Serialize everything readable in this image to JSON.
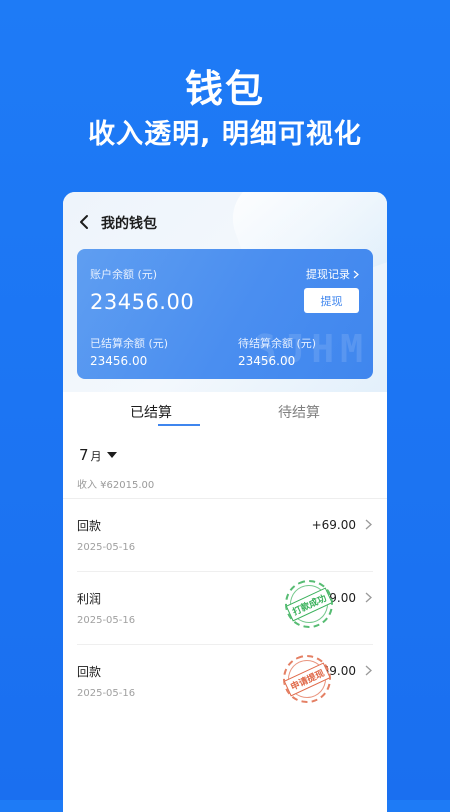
{
  "promo": {
    "title": "钱包",
    "subtitle": "收入透明, 明细可视化"
  },
  "nav": {
    "back_icon": "chevron-left-icon",
    "title": "我的钱包"
  },
  "balance_card": {
    "account_balance_label": "账户余额 (元)",
    "account_balance": "23456.00",
    "withdraw_record_label": "提现记录",
    "withdraw_button_label": "提现",
    "settled_label": "已结算余额 (元)",
    "settled_amount": "23456.00",
    "pending_label": "待结算余额 (元)",
    "pending_amount": "23456.00",
    "watermark": "SJHM"
  },
  "tabs": [
    {
      "label": "已结算",
      "active": true
    },
    {
      "label": "待结算",
      "active": false
    }
  ],
  "filter": {
    "month": "7",
    "month_unit": "月",
    "income_summary": "收入 ¥62015.00"
  },
  "records": [
    {
      "name": "回款",
      "date": "2025-05-16",
      "amount": "+69.00",
      "stamp": ""
    },
    {
      "name": "利润",
      "date": "2025-05-16",
      "amount": "+69.00",
      "stamp": "打款成功"
    },
    {
      "name": "回款",
      "date": "2025-05-16",
      "amount": "+69.00",
      "stamp": "申请提现"
    }
  ],
  "colors": {
    "background": "#1e7bf6",
    "accent": "#3f86ee",
    "stamp_success": "#3ab15b",
    "stamp_pending": "#e06a4a"
  }
}
